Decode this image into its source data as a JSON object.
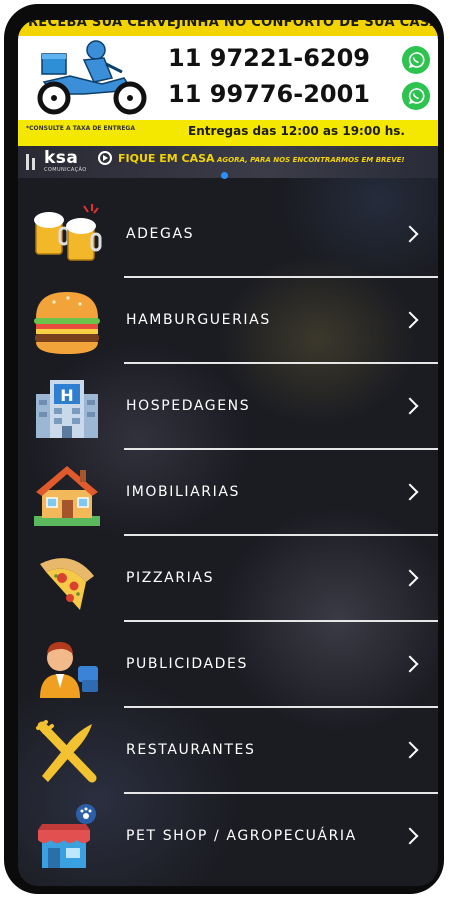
{
  "banner": {
    "top_strip_text": "RECEBA SUA CERVEJINHA NO CONFORTO DE SUA CASA",
    "phone_1": "11 97221-6209",
    "phone_2": "11 99776-2001",
    "delivery_note": "*CONSULTE A TAXA DE ENTREGA",
    "delivery_hours": "Entregas das 12:00 as 19:00 hs.",
    "brand_name": "ksa",
    "brand_sub": "COMUNICAÇÃO",
    "stay_home_bold": "FIQUE EM CASA",
    "stay_home_rest": " AGORA, PARA NOS ENCONTRARMOS EM BREVE!",
    "icons": {
      "whatsapp": "whatsapp-icon",
      "delivery": "motorbike-delivery-icon"
    }
  },
  "menu": {
    "items": [
      {
        "label": "ADEGAS",
        "icon": "beer-mugs-icon"
      },
      {
        "label": "HAMBURGUERIAS",
        "icon": "hamburger-icon"
      },
      {
        "label": "HOSPEDAGENS",
        "icon": "hotel-icon"
      },
      {
        "label": "IMOBILIARIAS",
        "icon": "house-icon"
      },
      {
        "label": "PIZZARIAS",
        "icon": "pizza-slice-icon"
      },
      {
        "label": "PUBLICIDADES",
        "icon": "advertising-person-icon"
      },
      {
        "label": "RESTAURANTES",
        "icon": "fork-knife-icon"
      },
      {
        "label": "PET SHOP / AGROPECUÁRIA",
        "icon": "pet-shop-icon"
      }
    ]
  },
  "colors": {
    "banner_yellow": "#f5e800",
    "whatsapp_green": "#2dc34f",
    "background": "#1b1c22",
    "text": "#ffffff"
  }
}
